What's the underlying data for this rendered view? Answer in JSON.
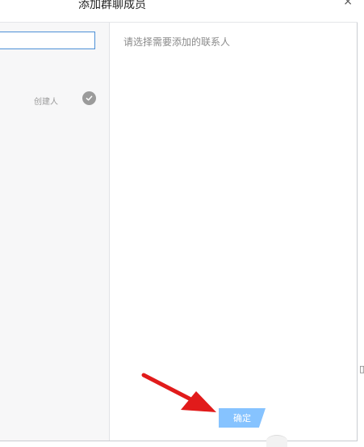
{
  "dialog": {
    "title": "添加群聊成员",
    "close_glyph": "×"
  },
  "left_panel": {
    "search_value": "",
    "members": [
      {
        "tag": "创建人",
        "selected_icon": "check-circle-icon"
      }
    ]
  },
  "right_panel": {
    "hint": "请选择需要添加的联系人"
  },
  "footer": {
    "confirm_label": "确定",
    "confirm_color": "#86c3ff"
  },
  "annotation": {
    "arrow_color": "#e11b1b"
  }
}
